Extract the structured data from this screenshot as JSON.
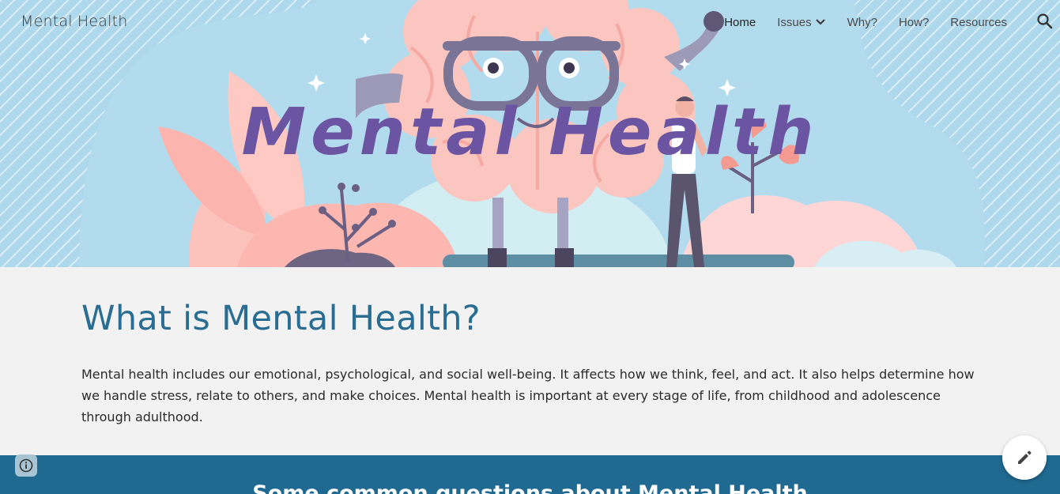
{
  "header": {
    "site_title": "Mental Health",
    "nav": {
      "home": "Home",
      "issues": "Issues",
      "why": "Why?",
      "how": "How?",
      "resources": "Resources"
    }
  },
  "hero": {
    "title": "Mental Health"
  },
  "intro": {
    "heading": "What is Mental Health?",
    "body": "Mental health includes our emotional, psychological, and social well-being. It affects how we think, feel, and act. It also helps determine how we handle stress, relate to others, and make choices. Mental health is important at every stage of life, from childhood and adolescence through adulthood."
  },
  "band": {
    "title": "Some common questions about Mental Health"
  },
  "icons": {
    "search": "search-icon",
    "chevron": "chevron-down-icon",
    "info": "info-icon",
    "edit": "pencil-icon"
  },
  "colors": {
    "hero_bg": "#aed8ec",
    "hero_title": "#6b55a2",
    "heading": "#2a6d93",
    "band": "#206a91",
    "page_bg": "#f2f2f2"
  }
}
